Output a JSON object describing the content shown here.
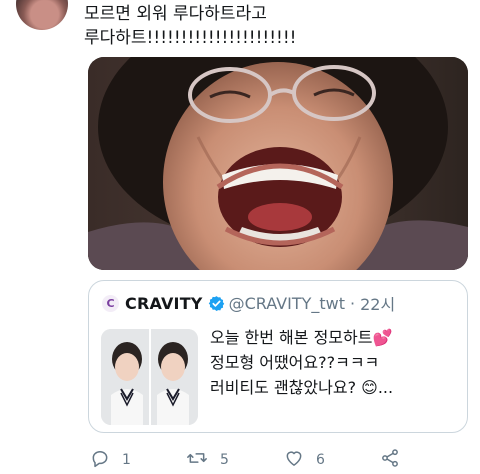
{
  "tweet": {
    "text": "모르면 외워 루다하트라고\n루다하트!!!!!!!!!!!!!!!!!!!!!!"
  },
  "quote": {
    "display_name": "CRAVITY",
    "handle": "@CRAVITY_twt",
    "separator": "·",
    "time": "22시",
    "text": "오늘 한번 해본 정모하트💕\n정모형 어땠어요??ㅋㅋㅋ\n러비티도 괜찮았나요? 😊...",
    "logo_letter": "C"
  },
  "actions": {
    "reply_count": "1",
    "retweet_count": "5",
    "like_count": "6"
  },
  "icons": {
    "verified": "verified-badge-icon",
    "reply": "reply-icon",
    "retweet": "retweet-icon",
    "like": "heart-icon",
    "share": "share-icon"
  },
  "colors": {
    "secondary_text": "#657786",
    "verified_blue": "#1da1f2",
    "border": "#ccd6dd",
    "brand_purple": "#7b3fa0"
  }
}
